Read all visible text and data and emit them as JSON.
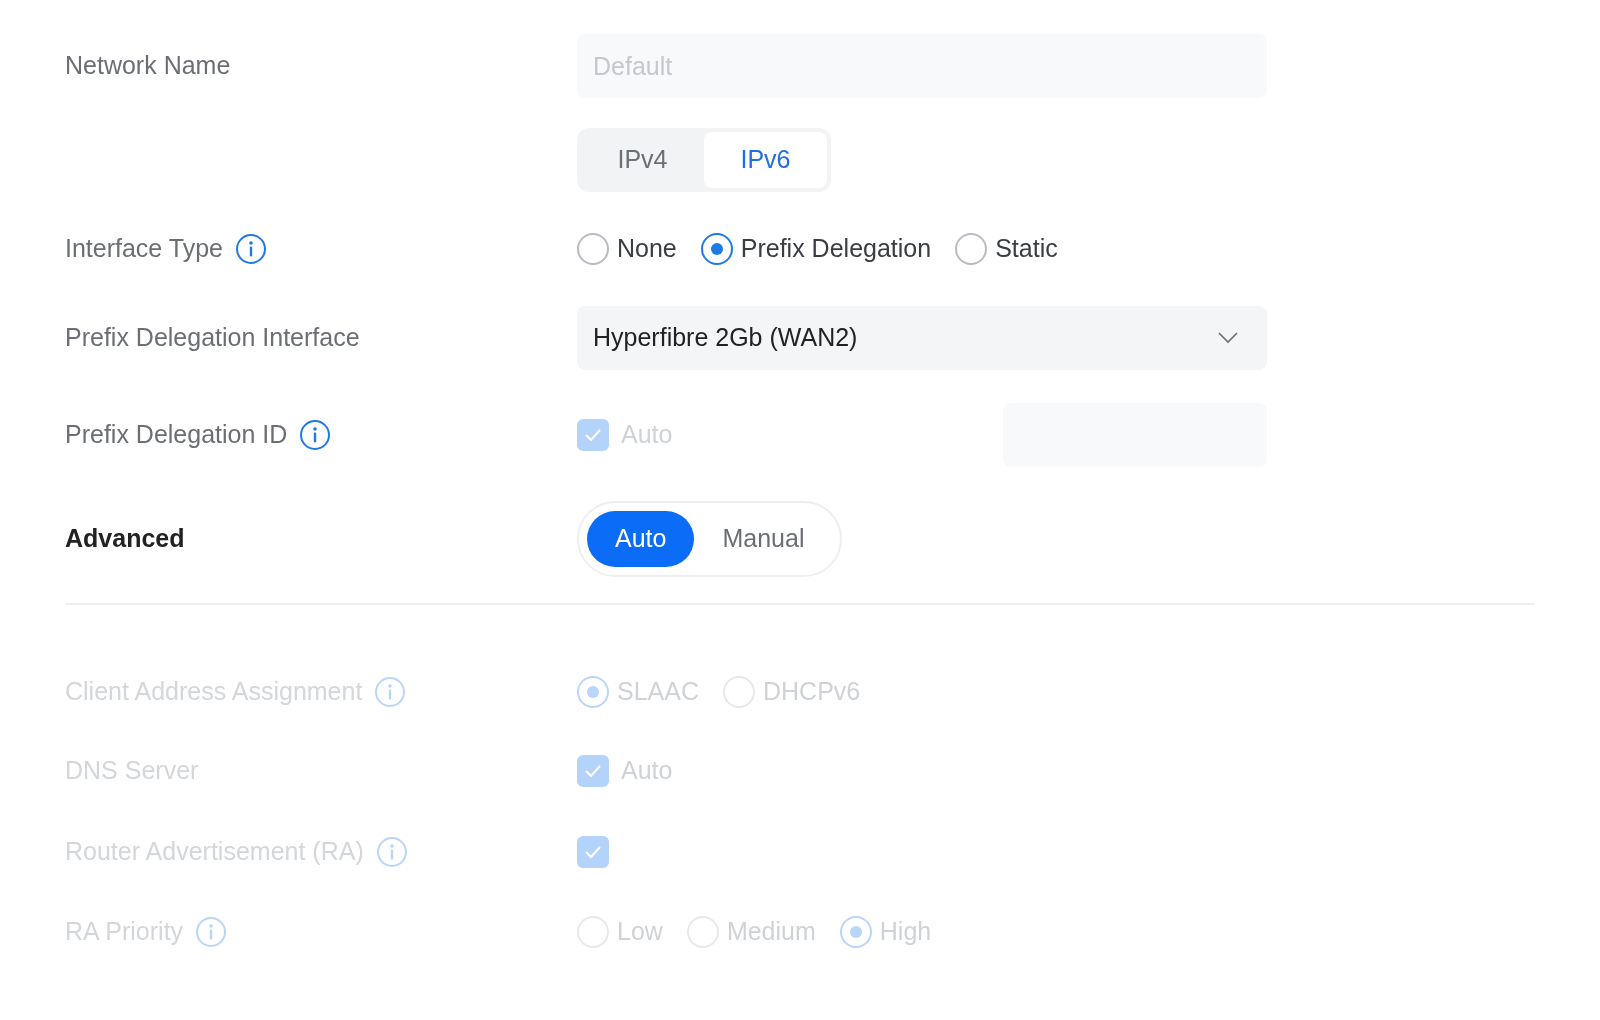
{
  "fields": [
    {
      "kind": "text",
      "label": "Network Name",
      "placeholder": "Default",
      "disabled": false,
      "info": false
    },
    {
      "kind": "segmented",
      "options": [
        {
          "label": "IPv4",
          "selected": false
        },
        {
          "label": "IPv6",
          "selected": true
        }
      ]
    },
    {
      "kind": "radio",
      "label": "Interface Type",
      "info": true,
      "disabled": false,
      "options": [
        {
          "label": "None",
          "selected": false
        },
        {
          "label": "Prefix Delegation",
          "selected": true
        },
        {
          "label": "Static",
          "selected": false
        }
      ]
    },
    {
      "kind": "select",
      "label": "Prefix Delegation Interface",
      "info": false,
      "disabled": false,
      "value": "Hyperfibre 2Gb (WAN2)"
    },
    {
      "kind": "checkbox",
      "label": "Prefix Delegation ID",
      "info": true,
      "disabled": false,
      "checked": true,
      "check_disabled": true,
      "text": "Auto",
      "side_field": true
    }
  ],
  "advanced": {
    "label": "Advanced",
    "options": [
      {
        "label": "Auto",
        "selected": true
      },
      {
        "label": "Manual",
        "selected": false
      }
    ]
  },
  "advanced_fields": [
    {
      "kind": "radio",
      "label": "Client Address Assignment",
      "info": true,
      "disabled": true,
      "options": [
        {
          "label": "SLAAC",
          "selected": true
        },
        {
          "label": "DHCPv6",
          "selected": false
        }
      ]
    },
    {
      "kind": "checkbox",
      "label": "DNS Server",
      "info": false,
      "disabled": true,
      "checked": true,
      "check_disabled": true,
      "text": "Auto"
    },
    {
      "kind": "checkbox",
      "label": "Router Advertisement (RA)",
      "info": true,
      "disabled": true,
      "checked": true,
      "check_disabled": true
    },
    {
      "kind": "radio",
      "label": "RA Priority",
      "info": true,
      "disabled": true,
      "options": [
        {
          "label": "Low",
          "selected": false
        },
        {
          "label": "Medium",
          "selected": false
        },
        {
          "label": "High",
          "selected": true
        }
      ]
    }
  ]
}
